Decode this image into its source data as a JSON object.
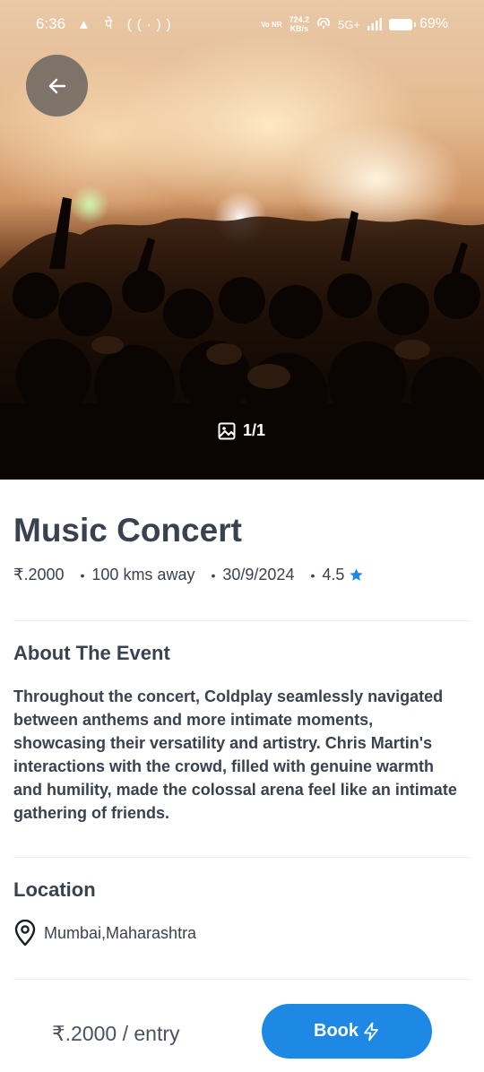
{
  "status_bar": {
    "time": "6:36",
    "left_icons": "▲ पे ((·))",
    "network_type": "Vo NR",
    "data_speed_value": "724.2",
    "data_speed_unit": "KB/s",
    "signal": "5G+",
    "battery": "69%"
  },
  "hero": {
    "image_counter": "1/1",
    "back_icon": "arrow-left-icon",
    "gallery_icon": "image-icon"
  },
  "event": {
    "title": "Music Concert",
    "price": "₹.2000",
    "distance": "100 kms away",
    "date": "30/9/2024",
    "rating": "4.5",
    "bullet": "•"
  },
  "about": {
    "heading": "About The Event",
    "text": "Throughout the concert, Coldplay seamlessly navigated between anthems and more intimate moments, showcasing their versatility and artistry. Chris Martin's interactions with the crowd, filled with genuine warmth and humility, made the colossal arena feel like an intimate gathering of friends."
  },
  "location": {
    "heading": "Location",
    "place": "Mumbai,Maharashtra",
    "icon": "location-pin-icon"
  },
  "footer": {
    "price_per_entry": "₹.2000 / entry",
    "book_label": "Book",
    "book_icon": "lightning-icon"
  },
  "colors": {
    "accent": "#1e88e5",
    "text": "#3a4250",
    "star": "#1e88e5"
  }
}
